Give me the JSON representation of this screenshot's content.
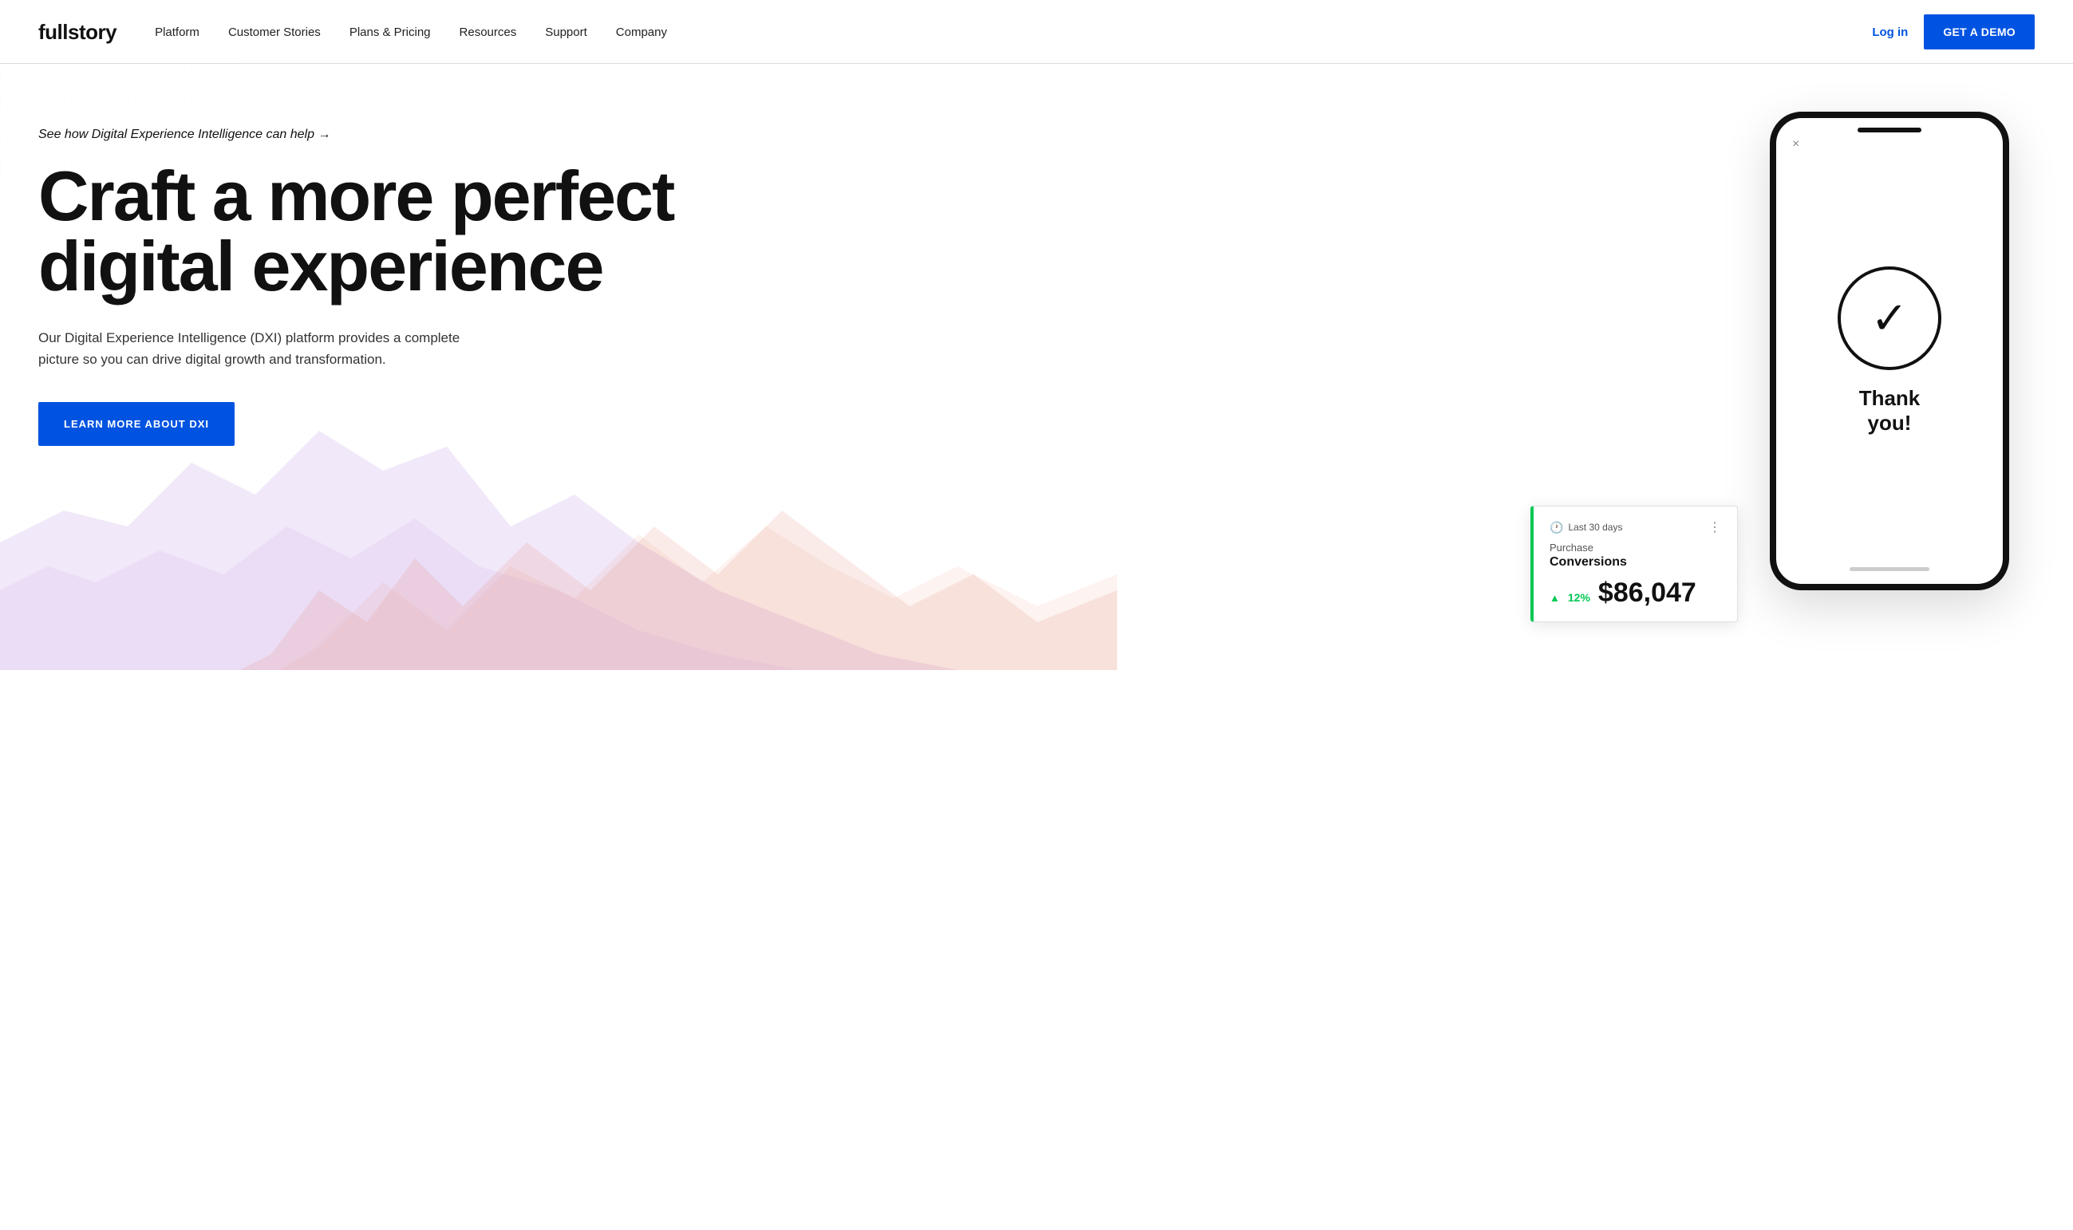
{
  "brand": {
    "name": "fullstory"
  },
  "nav": {
    "links": [
      {
        "label": "Platform",
        "id": "platform"
      },
      {
        "label": "Customer Stories",
        "id": "customer-stories"
      },
      {
        "label": "Plans & Pricing",
        "id": "plans-pricing"
      },
      {
        "label": "Resources",
        "id": "resources"
      },
      {
        "label": "Support",
        "id": "support"
      },
      {
        "label": "Company",
        "id": "company"
      }
    ],
    "login_label": "Log in",
    "demo_label": "GET A DEMO"
  },
  "hero": {
    "tagline": "See how Digital Experience Intelligence can help →",
    "title_line1": "Craft a more perfect",
    "title_line2": "digital experience",
    "description": "Our Digital Experience Intelligence (DXI) platform provides a complete picture so you can drive digital growth and transformation.",
    "cta_label": "LEARN MORE ABOUT DXI"
  },
  "phone": {
    "close_icon": "×",
    "thank_you_text": "Thank\nyou!",
    "bottom_bar": true
  },
  "conversion_card": {
    "icon": "🕐",
    "date_range": "Last 30 days",
    "dots": "⋮",
    "label": "Purchase",
    "title": "Conversions",
    "up_arrow": "▲",
    "percentage": "12%",
    "value": "$86,047"
  },
  "colors": {
    "blue": "#0053e0",
    "green": "#00c853",
    "text_dark": "#111111",
    "text_mid": "#333333",
    "border": "#dddddd"
  }
}
